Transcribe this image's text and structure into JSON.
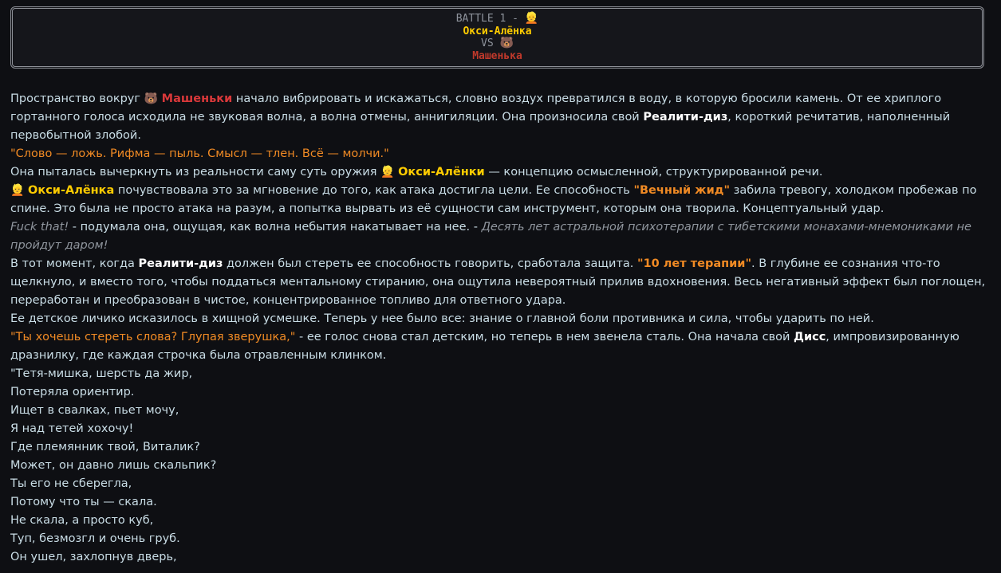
{
  "header": {
    "battle_label": "BATTLE 1 - ",
    "p1_icon": "👱",
    "p1_name": "Окси-Алёнка",
    "vs_label": "VS ",
    "p2_icon": "🐻",
    "p2_name": "Машенька"
  },
  "story": {
    "p1": {
      "t1": "Пространство вокруг ",
      "icon": "🐻",
      "name": "Машеньки",
      "t2": " начало вибрировать и искажаться, словно воздух превратился в воду, в которую бросили камень. От ее хриплого гортанного голоса исходила не звуковая волна, а волна отмены, аннигиляции. Она произносила свой ",
      "term": "Реалити-диз",
      "t3": ", короткий речитатив, наполненный первобытной злобой."
    },
    "p2": {
      "quote": "\"Слово — ложь. Рифма — пыль. Смысл — тлен. Всё — молчи.\""
    },
    "p3": {
      "t1": "Она пыталась вычеркнуть из реальности саму суть оружия ",
      "icon": "👱",
      "name": "Окси-Алёнки",
      "t2": " — концепцию осмысленной, структурированной речи."
    },
    "p4": {
      "icon": "👱",
      "name": "Окси-Алёнка",
      "t1": " почувствовала это за мгновение до того, как атака достигла цели. Ее способность ",
      "ability": "\"Вечный жид\"",
      "t2": " забила тревогу, холодком пробежав по спине. Это была не просто атака на разум, а попытка вырвать из её сущности сам инструмент, которым она творила. Концептуальный удар."
    },
    "p5": {
      "thought1": "Fuck that!",
      "t1": " - подумала она, ощущая, как волна небытия накатывает на нее. - ",
      "thought2": "Десять лет астральной психотерапии с тибетскими монахами-мнемониками не пройдут даром!"
    },
    "p6": {
      "t1": "В тот момент, когда ",
      "term": "Реалити-диз",
      "t2": " должен был стереть ее способность говорить, сработала защита. ",
      "ability": "\"10 лет терапии\"",
      "t3": ". В глубине ее сознания что-то щелкнуло, и вместо того, чтобы поддаться ментальному стиранию, она ощутила невероятный прилив вдохновения. Весь негативный эффект был поглощен, переработан и преобразован в чистое, концентрированное топливо для ответного удара."
    },
    "p7": {
      "text": "Ее детское личико исказилось в хищной усмешке. Теперь у нее было все: знание о главной боли противника и сила, чтобы ударить по ней."
    },
    "p8": {
      "quote": "\"Ты хочешь стереть слова? Глупая зверушка,\"",
      "t1": " - ее голос снова стал детским, но теперь в нем звенела сталь. Она начала свой ",
      "term": "Дисс",
      "t2": ", импровизированную дразнилку, где каждая строчка была отравленным клинком."
    },
    "poem": [
      "\"Тетя-мишка, шерсть да жир,",
      "Потеряла ориентир.",
      "Ищет в свалках, пьет мочу,",
      "Я над тетей хохочу!",
      "Где племянник твой, Виталик?",
      "Может, он давно лишь скальпик?",
      "Ты его не сберегла,",
      "Потому что ты — скала.",
      "Не скала, а просто куб,",
      "Туп, безмозгл и очень груб.",
      "Он ушел, захлопнув дверь,"
    ]
  }
}
